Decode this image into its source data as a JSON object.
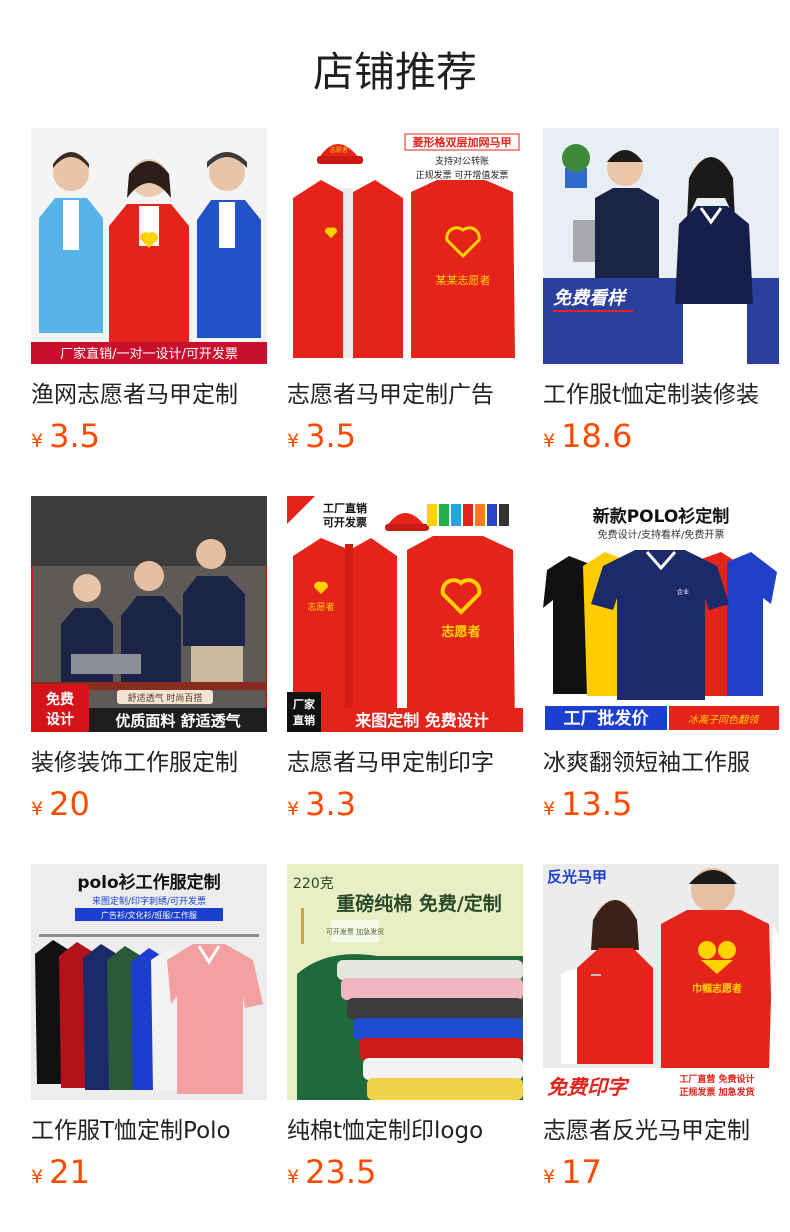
{
  "header": {
    "title": "店铺推荐"
  },
  "currency_symbol": "¥",
  "products": [
    {
      "title": "渔网志愿者马甲定制",
      "price": "3.5",
      "image_text": {
        "banner": "厂家直销/一对一设计/可开发票"
      }
    },
    {
      "title": "志愿者马甲定制广告",
      "price": "3.5",
      "image_text": {
        "headline": "菱形格双层加网马甲",
        "line1": "支持对公转账",
        "line2": "正规发票 可开增值发票",
        "back_text": "某某志愿者"
      }
    },
    {
      "title": "工作服t恤定制装修装",
      "price": "18.6",
      "image_text": {
        "badge": "免费看样"
      }
    },
    {
      "title": "装修装饰工作服定制",
      "price": "20",
      "image_text": {
        "badge_top": "免费",
        "badge_bottom": "设计",
        "tag": "舒适透气 时尚百搭",
        "banner": "优质面料 舒适透气"
      }
    },
    {
      "title": "志愿者马甲定制印字",
      "price": "3.3",
      "image_text": {
        "corner": "工厂直销",
        "corner2": "可开发票",
        "front_text": "志愿者",
        "back_text": "志愿者",
        "box_top": "厂家",
        "box_bottom": "直销",
        "banner": "来图定制 免费设计"
      }
    },
    {
      "title": "冰爽翻领短袖工作服",
      "price": "13.5",
      "image_text": {
        "headline": "新款POLO衫定制",
        "sub": "免费设计/支持看样/免费开票",
        "banner_left": "工厂批发价",
        "banner_right": "冰离子同色翻领"
      }
    },
    {
      "title": "工作服T恤定制Polo",
      "price": "21",
      "image_text": {
        "headline": "polo衫工作服定制",
        "sub": "来图定制/印字刺绣/可开发票",
        "sub2": "广告衫/文化衫/班服/工作服"
      }
    },
    {
      "title": "纯棉t恤定制印logo",
      "price": "23.5",
      "image_text": {
        "weight": "220克",
        "headline": "重磅纯棉 免费/定制",
        "tag": "可开发票 加急发货"
      }
    },
    {
      "title": "志愿者反光马甲定制",
      "price": "17",
      "image_text": {
        "corner": "反光马甲",
        "vest_text": "巾帼志愿者",
        "banner": "免费印字",
        "banner_r1": "工厂直营 免费设计",
        "banner_r2": "正规发票 加急发货"
      }
    }
  ],
  "colors": {
    "price": "#ff4a00",
    "title": "#222222",
    "accent_red": "#e4231a"
  }
}
